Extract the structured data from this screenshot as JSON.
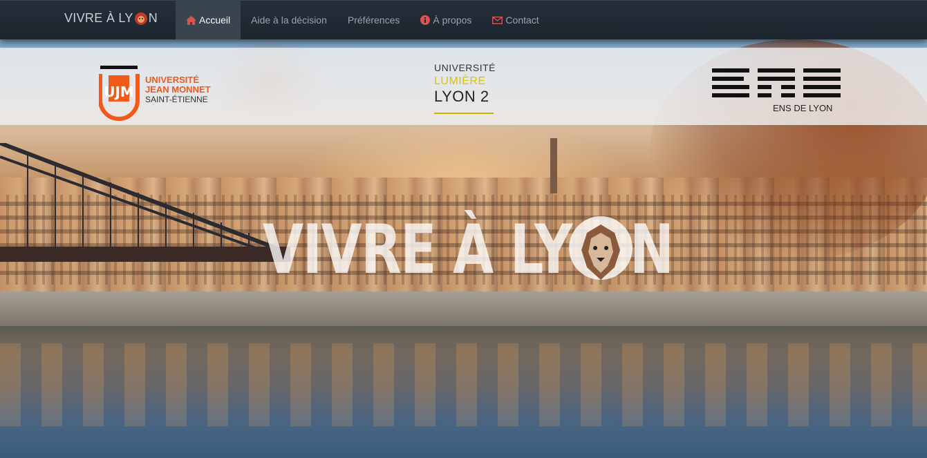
{
  "navbar": {
    "brand_pre": "VIVRE À LY",
    "brand_post": "N",
    "items": [
      {
        "label": "Accueil",
        "icon": "home-icon",
        "active": true
      },
      {
        "label": "Aide à la décision",
        "icon": "",
        "active": false
      },
      {
        "label": "Préférences",
        "icon": "",
        "active": false
      },
      {
        "label": "À propos",
        "icon": "info-circle-icon",
        "active": false
      },
      {
        "label": "Contact",
        "icon": "envelope-icon",
        "active": false
      }
    ]
  },
  "logos": {
    "ujm": {
      "line1": "UNIVERSITÉ",
      "line2": "JEAN MONNET",
      "line3": "SAINT-ÉTIENNE"
    },
    "lyon2": {
      "line1": "UNIVERSITÉ",
      "line2": "LUMIÈRE",
      "line3": "LYON 2"
    },
    "ens": {
      "label": "ENS DE LYON"
    }
  },
  "hero": {
    "title_pre": "VIVRE À LY",
    "title_post": "N"
  },
  "colors": {
    "navbar_bg": "#1c242c",
    "nav_active_bg": "#3a444e",
    "ujm_orange": "#f05a1a",
    "lyon2_yellow": "#d9c400",
    "icon_red": "#d9534f"
  }
}
